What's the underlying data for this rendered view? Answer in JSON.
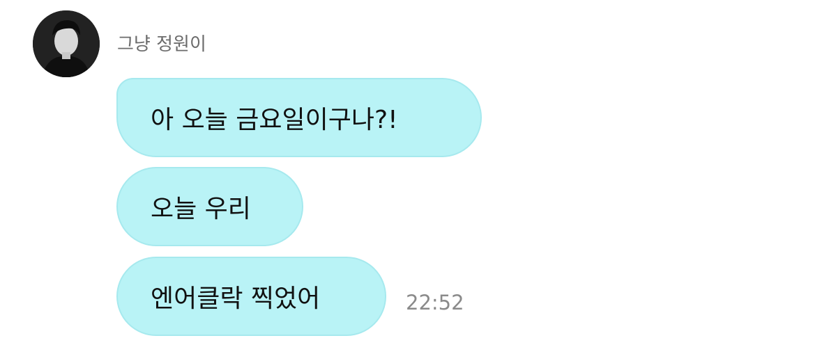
{
  "chat": {
    "sender": {
      "name": "그냥 정원이",
      "avatar_icon": "profile-photo-avatar"
    },
    "messages": [
      {
        "text": "아 오늘 금요일이구나?!"
      },
      {
        "text": "오늘 우리"
      },
      {
        "text": "엔어클락 찍었어",
        "time": "22:52"
      }
    ],
    "colors": {
      "bubble": "#b9f3f6",
      "bubble_border": "#a6e9ee",
      "name_text": "#6b6b6b",
      "time_text": "#8a8a8a"
    }
  }
}
